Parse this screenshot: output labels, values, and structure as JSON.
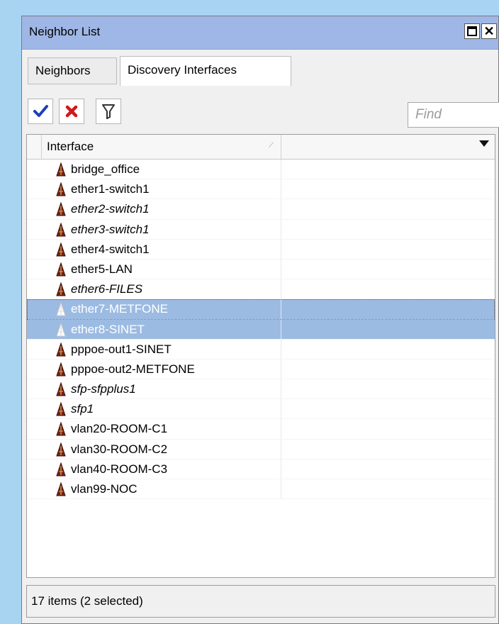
{
  "window": {
    "title": "Neighbor List"
  },
  "tabs": [
    {
      "label": "Neighbors",
      "active": false
    },
    {
      "label": "Discovery Interfaces",
      "active": true
    }
  ],
  "toolbar": {
    "search_placeholder": "Find"
  },
  "table": {
    "columns": [
      {
        "label": "Interface",
        "sort": "ascending"
      }
    ],
    "rows": [
      {
        "name": "bridge_office",
        "state": "enabled",
        "italic": false
      },
      {
        "name": "ether1-switch1",
        "state": "enabled",
        "italic": false
      },
      {
        "name": "ether2-switch1",
        "state": "enabled",
        "italic": true
      },
      {
        "name": "ether3-switch1",
        "state": "enabled",
        "italic": true
      },
      {
        "name": "ether4-switch1",
        "state": "enabled",
        "italic": false
      },
      {
        "name": "ether5-LAN",
        "state": "enabled",
        "italic": false
      },
      {
        "name": "ether6-FILES",
        "state": "enabled",
        "italic": true
      },
      {
        "name": "ether7-METFONE",
        "state": "selected-disabled",
        "italic": false
      },
      {
        "name": "ether8-SINET",
        "state": "selected-disabled",
        "italic": false
      },
      {
        "name": "pppoe-out1-SINET",
        "state": "enabled",
        "italic": false
      },
      {
        "name": "pppoe-out2-METFONE",
        "state": "enabled",
        "italic": false
      },
      {
        "name": "sfp-sfpplus1",
        "state": "enabled",
        "italic": true
      },
      {
        "name": "sfp1",
        "state": "enabled",
        "italic": true
      },
      {
        "name": "vlan20-ROOM-C1",
        "state": "enabled",
        "italic": false
      },
      {
        "name": "vlan30-ROOM-C2",
        "state": "enabled",
        "italic": false
      },
      {
        "name": "vlan40-ROOM-C3",
        "state": "enabled",
        "italic": false
      },
      {
        "name": "vlan99-NOC",
        "state": "enabled",
        "italic": false
      }
    ]
  },
  "status": {
    "text": "17 items (2 selected)"
  },
  "colors": {
    "titlebar": "#9fb7e6",
    "selection": "#9cbbe3",
    "icon": "#7a1f14",
    "enable_check": "#1d3fb8",
    "disable_x": "#d01818"
  }
}
